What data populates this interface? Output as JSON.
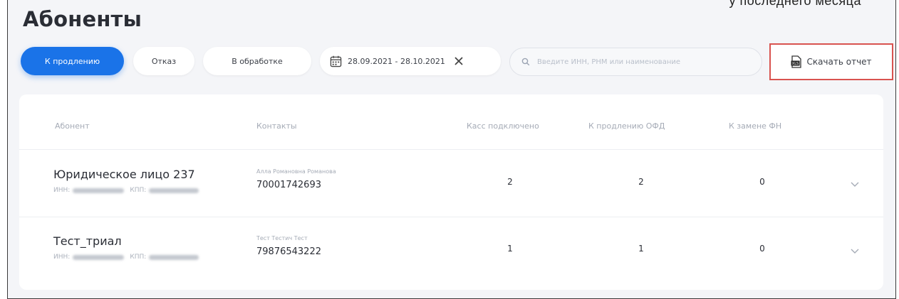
{
  "header": {
    "cut_text": "у последнего месяца",
    "title": "Абоненты"
  },
  "filters": {
    "tabs": [
      {
        "label": "К продлению",
        "active": true
      },
      {
        "label": "Отказ",
        "active": false
      },
      {
        "label": "В обработке",
        "active": false
      }
    ],
    "date_range": "28.09.2021 - 28.10.2021",
    "search_placeholder": "Введите ИНН, РНМ или наименование",
    "download_label": "Скачать отчет"
  },
  "table": {
    "columns": [
      "Абонент",
      "Контакты",
      "Касс подключено",
      "К продлению ОФД",
      "К замене ФН"
    ],
    "rows": [
      {
        "name": "Юридическое лицо 237",
        "inn_label": "ИНН:",
        "kpp_label": "КПП:",
        "contact_name": "Алла Романовна Романова",
        "phone": "70001742693",
        "kass": "2",
        "ofd": "2",
        "fn": "0"
      },
      {
        "name": "Тест_триал",
        "inn_label": "ИНН:",
        "kpp_label": "КПП:",
        "contact_name": "Тест Тестич Тест",
        "phone": "79876543222",
        "kass": "1",
        "ofd": "1",
        "fn": "0"
      }
    ]
  },
  "colors": {
    "accent": "#1a73e8",
    "highlight_border": "#d9534f",
    "background": "#f4f5f8"
  },
  "icons": [
    "calendar-icon",
    "close-icon",
    "search-icon",
    "xls-file-icon",
    "chevron-down-icon"
  ]
}
